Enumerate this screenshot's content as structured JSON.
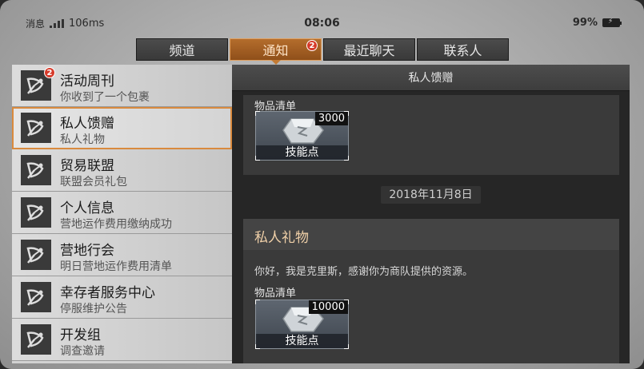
{
  "status_bar": {
    "carrier_label": "消息",
    "latency": "106ms",
    "time": "08:06",
    "battery_percent": "99%"
  },
  "tabs": [
    {
      "label": "频道",
      "active": false,
      "badge": ""
    },
    {
      "label": "通知",
      "active": true,
      "badge": "2"
    },
    {
      "label": "最近聊天",
      "active": false,
      "badge": ""
    },
    {
      "label": "联系人",
      "active": false,
      "badge": ""
    }
  ],
  "mail_list": [
    {
      "title": "活动周刊",
      "subtitle": "你收到了一个包裹",
      "badge": "2",
      "selected": false
    },
    {
      "title": "私人馈赠",
      "subtitle": "私人礼物",
      "badge": "",
      "selected": true
    },
    {
      "title": "贸易联盟",
      "subtitle": "联盟会员礼包",
      "badge": "",
      "selected": false
    },
    {
      "title": "个人信息",
      "subtitle": "营地运作费用缴纳成功",
      "badge": "",
      "selected": false
    },
    {
      "title": "营地行会",
      "subtitle": "明日营地运作费用清单",
      "badge": "",
      "selected": false
    },
    {
      "title": "幸存者服务中心",
      "subtitle": "停服维护公告",
      "badge": "",
      "selected": false
    },
    {
      "title": "开发组",
      "subtitle": "调查邀请",
      "badge": "",
      "selected": false
    }
  ],
  "detail": {
    "header": "私人馈赠",
    "card1": {
      "list_label": "物品清单",
      "item": {
        "quantity": "3000",
        "name": "技能点"
      }
    },
    "date": "2018年11月8日",
    "card2": {
      "title": "私人礼物",
      "body": "你好，我是克里斯，感谢你为商队提供的资源。",
      "list_label": "物品清单",
      "item": {
        "quantity": "10000",
        "name": "技能点"
      }
    }
  },
  "colors": {
    "accent": "#c27a33",
    "badge": "#d63a2a"
  }
}
